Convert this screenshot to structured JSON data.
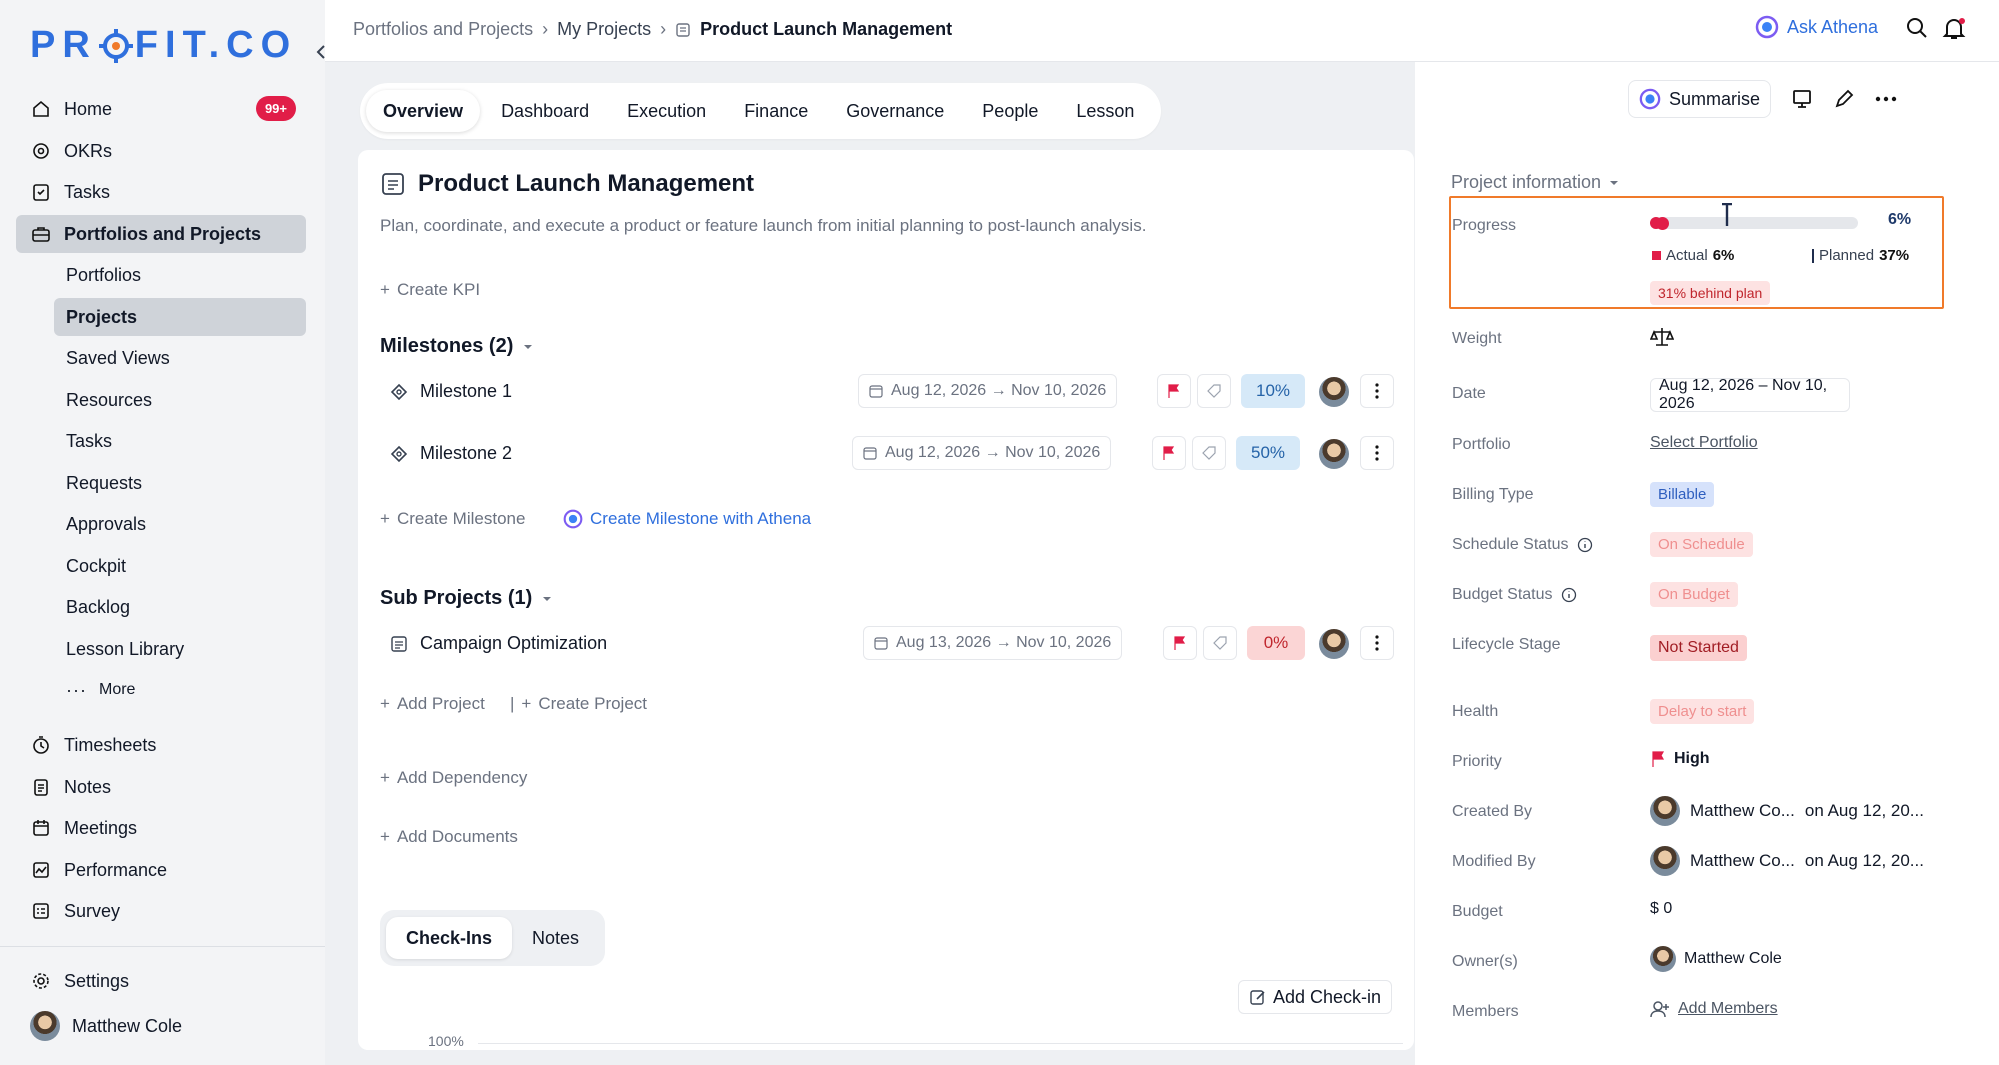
{
  "brand": {
    "logo": "PROFIT.CO"
  },
  "sidebar": {
    "notification_badge": "99+",
    "items": [
      {
        "label": "Home",
        "icon": "home-icon"
      },
      {
        "label": "OKRs",
        "icon": "target-icon"
      },
      {
        "label": "Tasks",
        "icon": "task-icon"
      },
      {
        "label": "Portfolios and Projects",
        "icon": "briefcase-icon"
      }
    ],
    "sub_items": [
      "Portfolios",
      "Projects",
      "Saved Views",
      "Resources",
      "Tasks",
      "Requests",
      "Approvals",
      "Cockpit",
      "Backlog",
      "Lesson Library",
      "More"
    ],
    "bottom_items": [
      {
        "label": "Timesheets",
        "icon": "clock-icon"
      },
      {
        "label": "Notes",
        "icon": "notes-icon"
      },
      {
        "label": "Meetings",
        "icon": "calendar-icon"
      },
      {
        "label": "Performance",
        "icon": "performance-icon"
      },
      {
        "label": "Survey",
        "icon": "survey-icon"
      }
    ],
    "settings_label": "Settings",
    "user_name": "Matthew Cole"
  },
  "topbar": {
    "breadcrumb": [
      "Portfolios and Projects",
      "My Projects",
      "Product Launch Management"
    ],
    "ask_label": "Ask Athena"
  },
  "tabs": [
    "Overview",
    "Dashboard",
    "Execution",
    "Finance",
    "Governance",
    "People",
    "Lesson"
  ],
  "project": {
    "title": "Product Launch Management",
    "description": "Plan, coordinate, and execute a product or feature launch from initial planning to post-launch analysis.",
    "create_kpi": "Create KPI",
    "milestones_title": "Milestones (2)",
    "milestones": [
      {
        "name": "Milestone 1",
        "dates": "Aug 12, 2026 → Nov 10, 2026",
        "percent": "10%"
      },
      {
        "name": "Milestone 2",
        "dates": "Aug 12, 2026 → Nov 10, 2026",
        "percent": "50%"
      }
    ],
    "create_milestone": "Create Milestone",
    "create_milestone_athena": "Create Milestone with Athena",
    "subprojects_title": "Sub Projects (1)",
    "subprojects": [
      {
        "name": "Campaign Optimization",
        "dates": "Aug 13, 2026 → Nov 10, 2026",
        "percent": "0%"
      }
    ],
    "add_project": "Add Project",
    "create_project": "Create Project",
    "add_dependency": "Add Dependency",
    "add_documents": "Add Documents",
    "subtabs": [
      "Check-Ins",
      "Notes"
    ],
    "add_checkin": "Add Check-in",
    "chart_axis_top": "100%"
  },
  "info": {
    "summarise_label": "Summarise",
    "section_title": "Project information",
    "progress": {
      "label": "Progress",
      "value_label": "6%",
      "actual": 0.06,
      "planned": 0.37,
      "actual_label": "Actual",
      "actual_value": "6%",
      "planned_label": "Planned",
      "planned_value": "37%",
      "behind": "31% behind plan"
    },
    "weight_label": "Weight",
    "date_label": "Date",
    "date_value": "Aug 12, 2026 – Nov 10, 2026",
    "portfolio_label": "Portfolio",
    "portfolio_value": "Select Portfolio",
    "billing_label": "Billing Type",
    "billing_value": "Billable",
    "schedule_label": "Schedule Status",
    "schedule_value": "On Schedule",
    "budget_status_label": "Budget Status",
    "budget_status_value": "On Budget",
    "lifecycle_label": "Lifecycle Stage",
    "lifecycle_value": "Not Started",
    "health_label": "Health",
    "health_value": "Delay to start",
    "priority_label": "Priority",
    "priority_value": "High",
    "created_label": "Created By",
    "created_name": "Matthew Co...",
    "created_date": "on Aug 12, 20...",
    "modified_label": "Modified By",
    "modified_name": "Matthew Co...",
    "modified_date": "on Aug 12, 20...",
    "budget_label": "Budget",
    "budget_value": "$ 0",
    "owners_label": "Owner(s)",
    "owner_name": "Matthew Cole",
    "members_label": "Members",
    "members_value": "Add Members"
  },
  "colors": {
    "accent": "#2f6fdd",
    "highlight_border": "#f07a2a",
    "danger": "#e11d48"
  }
}
